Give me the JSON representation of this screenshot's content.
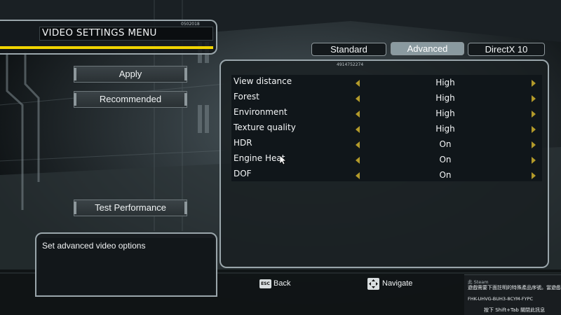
{
  "header": {
    "title": "VIDEO SETTINGS MENU",
    "serial": "0502018"
  },
  "buttons": {
    "apply": "Apply",
    "recommended": "Recommended",
    "test_performance": "Test Performance"
  },
  "tabs": [
    {
      "label": "Standard",
      "active": false
    },
    {
      "label": "Advanced",
      "active": true
    },
    {
      "label": "DirectX 10",
      "active": false
    }
  ],
  "panel": {
    "serial": "4914752274"
  },
  "settings": [
    {
      "label": "View distance",
      "value": "High"
    },
    {
      "label": "Forest",
      "value": "High"
    },
    {
      "label": "Environment",
      "value": "High"
    },
    {
      "label": "Texture quality",
      "value": "High"
    },
    {
      "label": "HDR",
      "value": "On"
    },
    {
      "label": "Engine Heat",
      "value": "On"
    },
    {
      "label": "DOF",
      "value": "On"
    }
  ],
  "description": "Set advanced video options",
  "hints": {
    "esc_key": "ESC",
    "back": "Back",
    "navigate": "Navigate"
  },
  "steam_popup": {
    "source": "此 Steam",
    "message": "遊戲需要下面註明的特殊產品序號。當遊戲",
    "key": "FHK-UHVG-BUH3-8CYM-FYPC",
    "footer": "按下 Shift+Tab 關閉此訊息"
  },
  "colors": {
    "accent_yellow": "#f0d400",
    "arrow_gold": "#b39a2a",
    "active_tab": "#8a9aa0"
  }
}
